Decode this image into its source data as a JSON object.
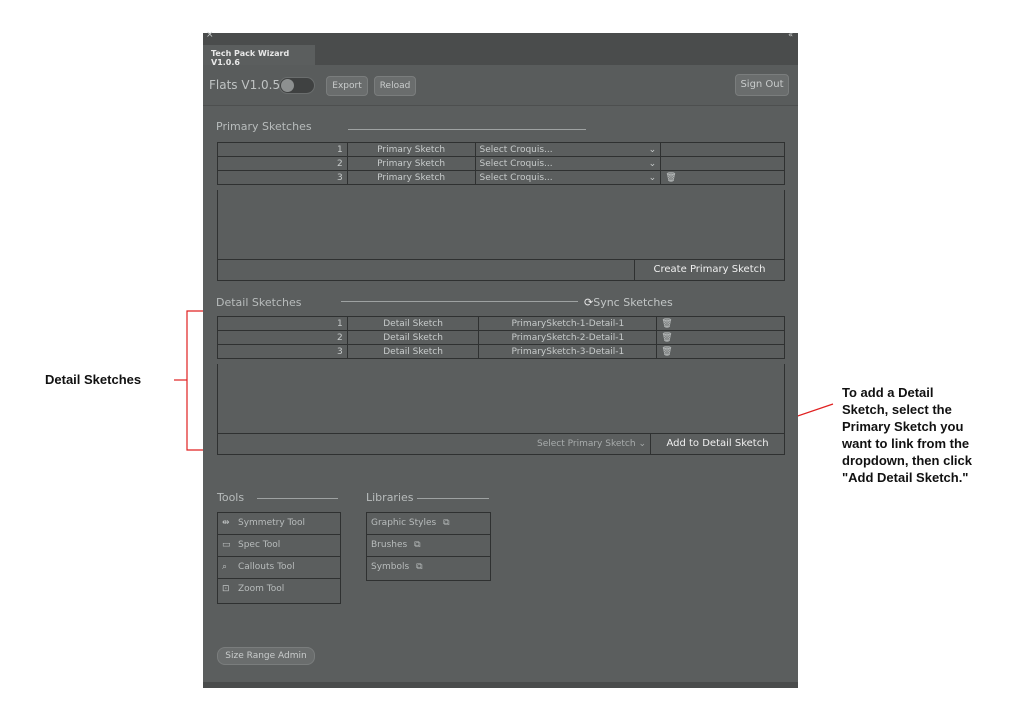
{
  "window": {
    "close_glyph": "×",
    "expand_glyph": "«",
    "tab_title": "Tech Pack Wizard V1.0.6"
  },
  "toolbar": {
    "flats_label": "Flats V1.0.5",
    "export_label": "Export",
    "reload_label": "Reload",
    "signout_label": "Sign Out"
  },
  "primary": {
    "title": "Primary Sketches",
    "rows": [
      {
        "num": "1",
        "name": "Primary Sketch",
        "select": "Select Croquis...",
        "chev": "⌄",
        "trash": ""
      },
      {
        "num": "2",
        "name": "Primary Sketch",
        "select": "Select Croquis...",
        "chev": "⌄",
        "trash": ""
      },
      {
        "num": "3",
        "name": "Primary Sketch",
        "select": "Select Croquis...",
        "chev": "⌄",
        "trash": "🗑"
      }
    ],
    "create_label": "Create Primary Sketch"
  },
  "detail": {
    "title": "Detail Sketches",
    "sync_label": "Sync Sketches",
    "rows": [
      {
        "num": "1",
        "name": "Detail Sketch",
        "link": "PrimarySketch-1-Detail-1",
        "trash": "🗑"
      },
      {
        "num": "2",
        "name": "Detail Sketch",
        "link": "PrimarySketch-2-Detail-1",
        "trash": "🗑"
      },
      {
        "num": "3",
        "name": "Detail Sketch",
        "link": "PrimarySketch-3-Detail-1",
        "trash": "🗑"
      }
    ],
    "select_primary_label": "Select Primary Sketch",
    "chev": "⌄",
    "add_label": "Add to Detail Sketch"
  },
  "tools": {
    "title": "Tools",
    "items": [
      {
        "label": "Symmetry Tool",
        "icon": "symmetry-icon",
        "glyph": "⇹"
      },
      {
        "label": "Spec Tool",
        "icon": "spec-icon",
        "glyph": "▭"
      },
      {
        "label": "Callouts Tool",
        "icon": "callouts-icon",
        "glyph": "⌕"
      },
      {
        "label": "Zoom Tool",
        "icon": "zoom-icon",
        "glyph": "⊡"
      }
    ]
  },
  "libraries": {
    "title": "Libraries",
    "items": [
      {
        "label": "Graphic Styles",
        "glyph": "⧉"
      },
      {
        "label": "Brushes",
        "glyph": "⧉"
      },
      {
        "label": "Symbols",
        "glyph": "⧉"
      }
    ]
  },
  "footer": {
    "size_range_label": "Size Range Admin"
  },
  "annotations": {
    "left_label": "Detail Sketches",
    "right_lines": [
      "To add a Detail",
      "Sketch, select the",
      "Primary Sketch you",
      "want to link from the",
      "dropdown, then click",
      "\"Add Detail Sketch.\""
    ]
  },
  "colors": {
    "panel": "#5b5e5e",
    "annotation_line": "#e02020",
    "text_light": "#c7cbcb"
  }
}
